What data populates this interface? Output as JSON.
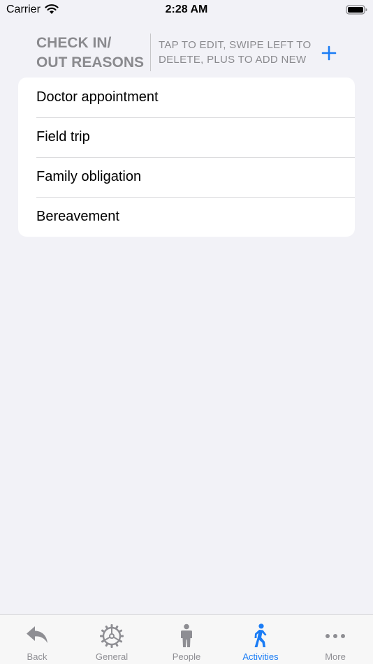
{
  "status_bar": {
    "carrier": "Carrier",
    "time": "2:28 AM"
  },
  "header": {
    "title": "CHECK IN/\nOUT REASONS",
    "hint": "TAP TO EDIT, SWIPE LEFT TO DELETE, PLUS TO ADD NEW",
    "add_icon": "plus-icon"
  },
  "reasons": [
    {
      "label": "Doctor appointment"
    },
    {
      "label": "Field trip"
    },
    {
      "label": "Family obligation"
    },
    {
      "label": "Bereavement"
    }
  ],
  "tab_bar": {
    "tabs": [
      {
        "label": "Back",
        "icon": "back-arrow-icon",
        "active": false
      },
      {
        "label": "General",
        "icon": "gear-icon",
        "active": false
      },
      {
        "label": "People",
        "icon": "person-icon",
        "active": false
      },
      {
        "label": "Activities",
        "icon": "walking-icon",
        "active": true
      },
      {
        "label": "More",
        "icon": "more-icon",
        "active": false
      }
    ]
  },
  "colors": {
    "accent": "#1a7cf5",
    "inactive": "#8e8e93",
    "background": "#f2f2f7"
  }
}
